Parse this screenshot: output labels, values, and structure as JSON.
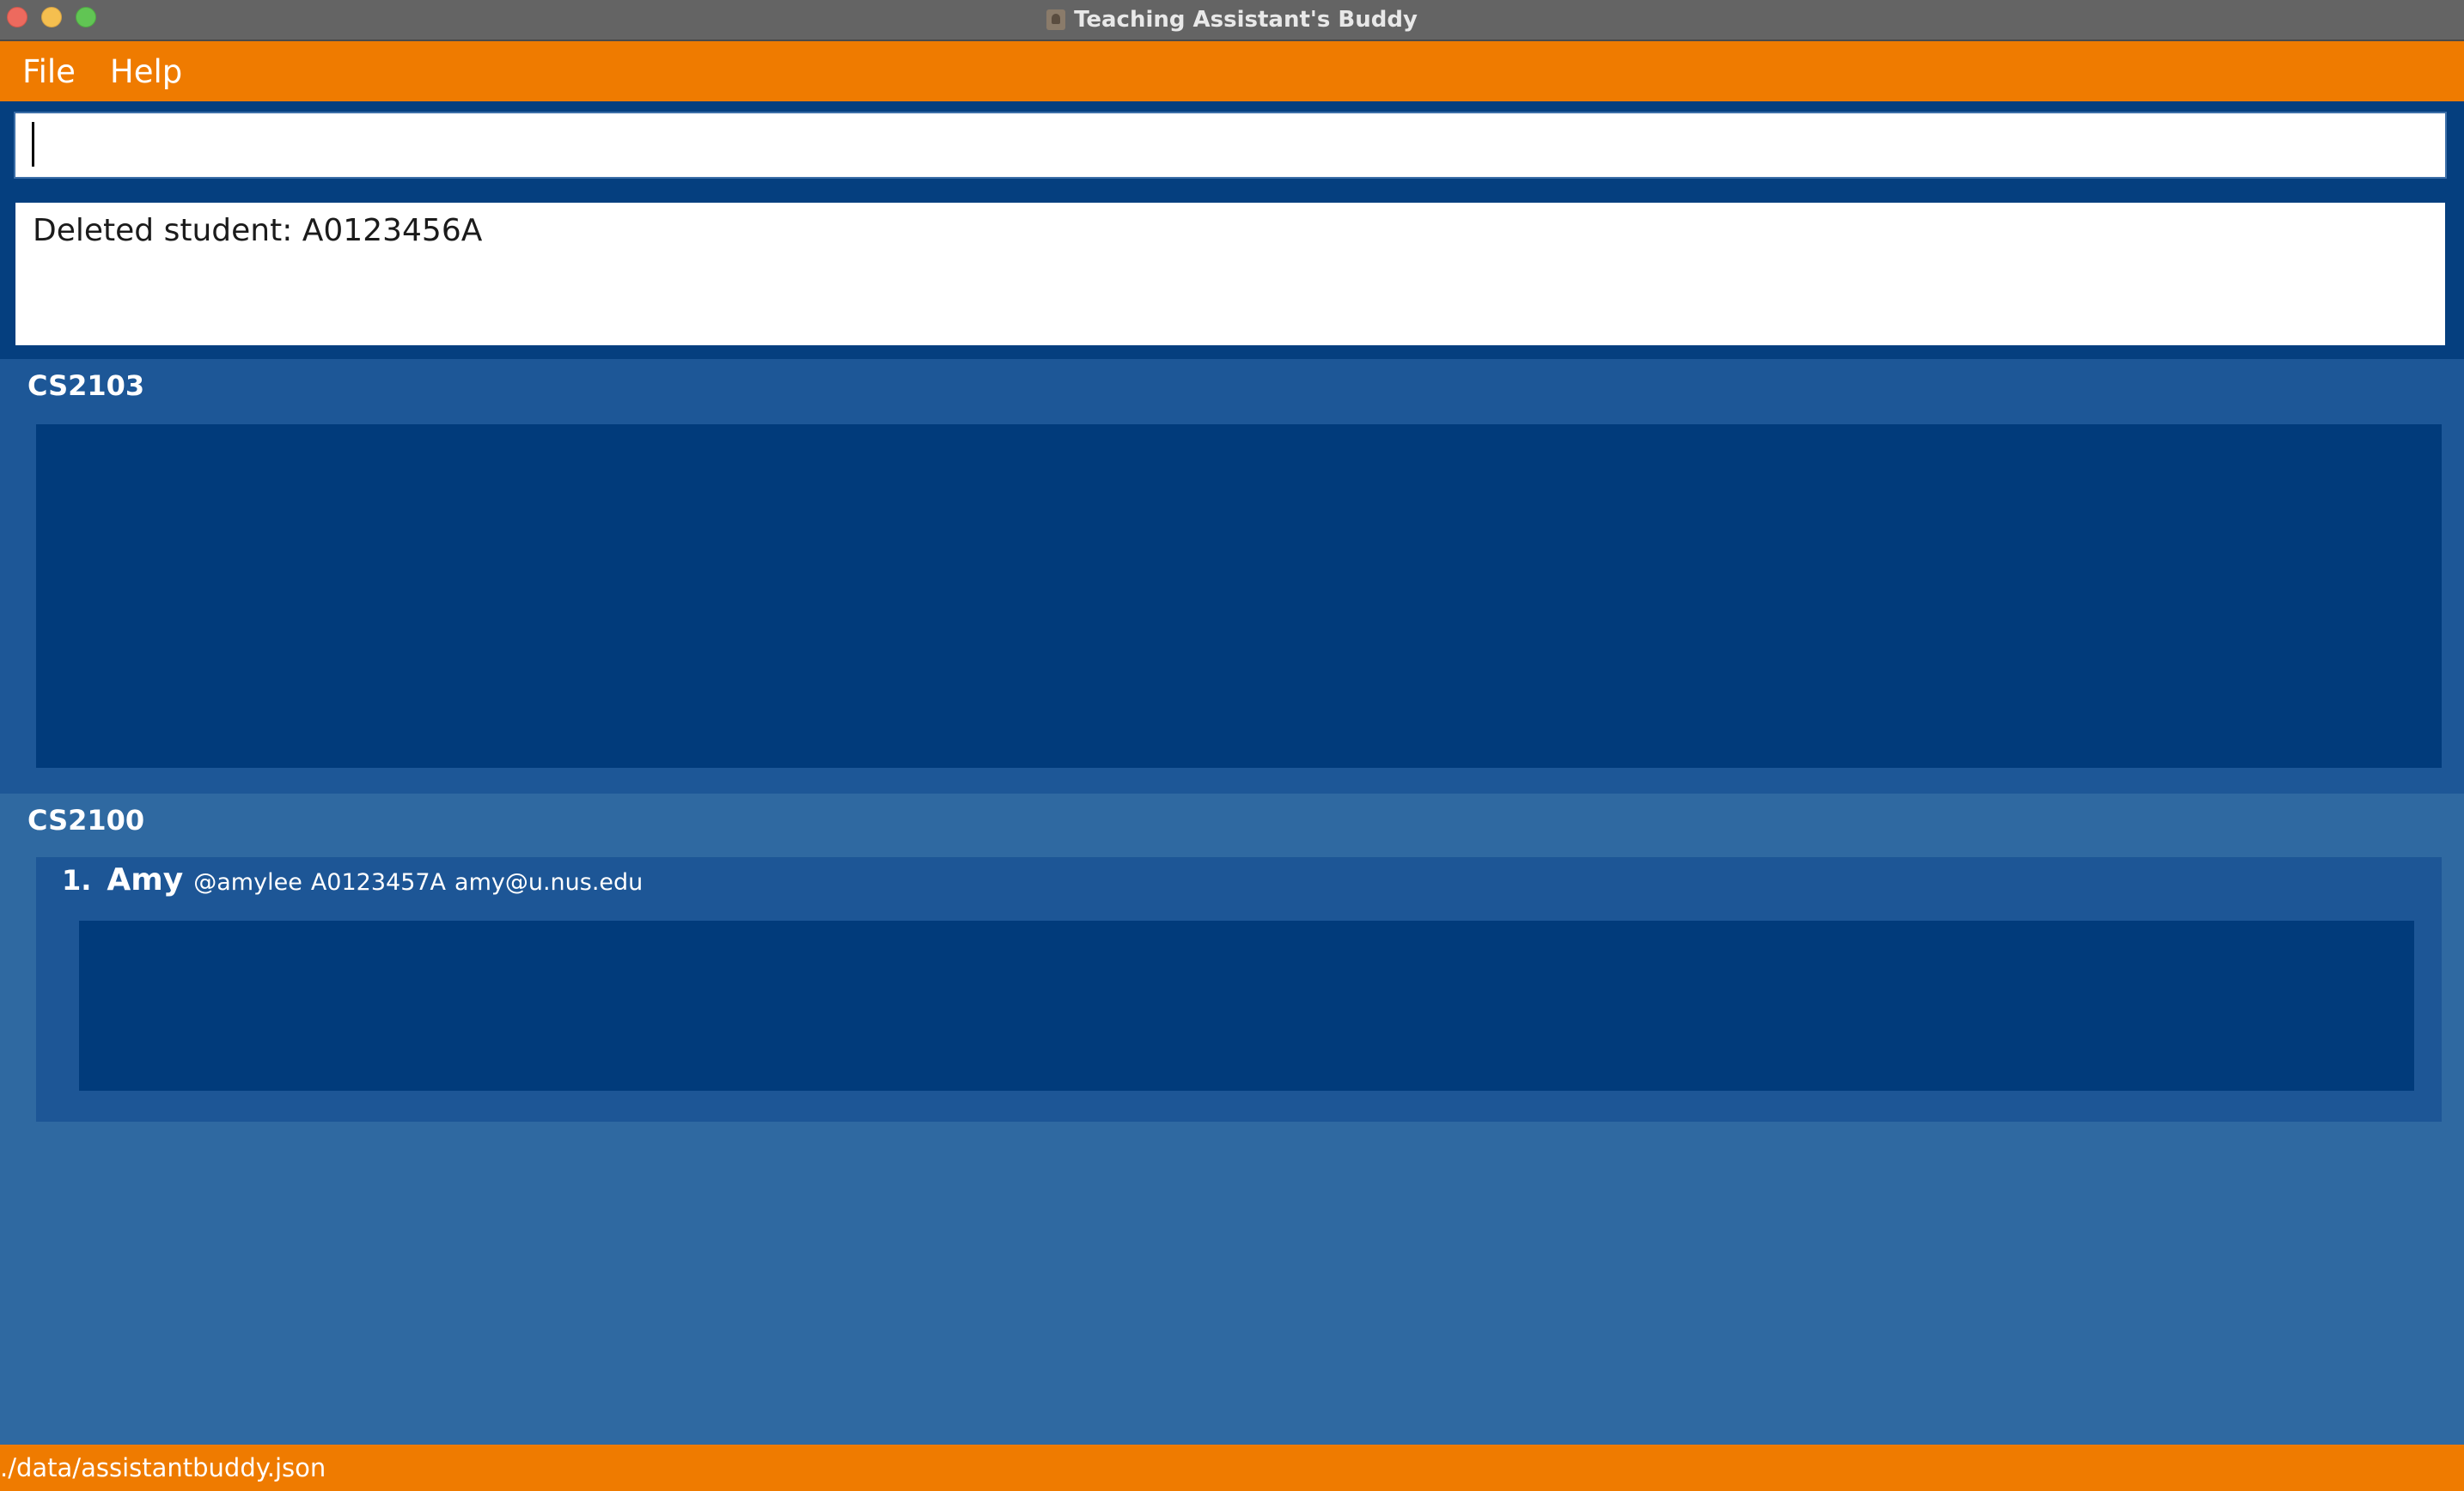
{
  "window": {
    "title": "Teaching Assistant's Buddy"
  },
  "menu": {
    "items": [
      {
        "label": "File"
      },
      {
        "label": "Help"
      }
    ]
  },
  "command": {
    "input_value": "",
    "placeholder": ""
  },
  "result": {
    "message": "Deleted student: A0123456A"
  },
  "modules": [
    {
      "code": "CS2103",
      "students": []
    },
    {
      "code": "CS2100",
      "students": [
        {
          "index": "1.",
          "name": "Amy",
          "telegram": "@amylee",
          "student_id": "A0123457A",
          "email": "amy@u.nus.edu"
        }
      ]
    }
  ],
  "status": {
    "file_path": "./data/assistantbuddy.json"
  },
  "colors": {
    "accent_orange": "#ef7b00",
    "primary_blue": "#053f7f",
    "panel_blue": "#1d5797",
    "background_blue": "#2f69a1"
  }
}
